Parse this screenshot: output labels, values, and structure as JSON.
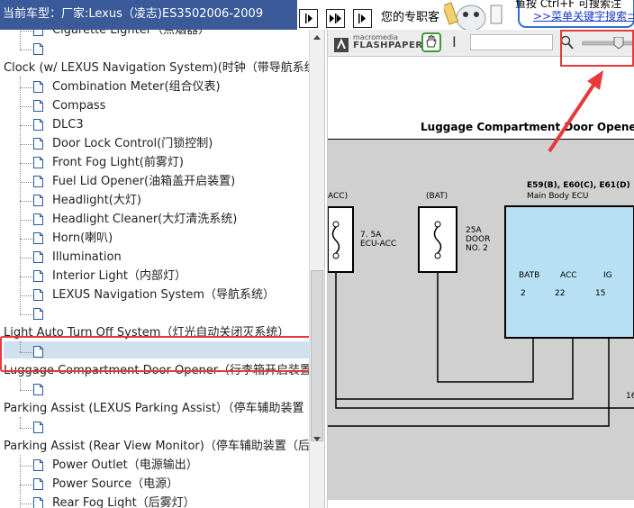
{
  "header": {
    "vehicle_prefix": "当前车型：",
    "vehicle_value": "厂家:Lexus（凌志)ES3502006-2009",
    "expert_label": "您的专职客",
    "tip_line1": "鱼按 Ctrl+F 可搜索注",
    "tip_line2": ">>菜单关键字搜索⊃"
  },
  "tree": {
    "items": [
      {
        "label": "Cigarette Lighter（点烟器）",
        "level": "child"
      },
      {
        "label": "",
        "level": "child"
      },
      {
        "label": "Clock (w/ LEXUS Navigation System)(时钟（带导航系统",
        "level": "parent"
      },
      {
        "label": "Combination Meter(组合仪表)",
        "level": "child"
      },
      {
        "label": "Compass",
        "level": "child"
      },
      {
        "label": "DLC3",
        "level": "child"
      },
      {
        "label": "Door Lock Control(门锁控制)",
        "level": "child"
      },
      {
        "label": "Front Fog Light(前雾灯)",
        "level": "child"
      },
      {
        "label": "Fuel Lid Opener(油箱盖开启装置)",
        "level": "child"
      },
      {
        "label": "Headlight(大灯)",
        "level": "child"
      },
      {
        "label": "Headlight Cleaner(大灯清洗系统)",
        "level": "child"
      },
      {
        "label": "Horn(喇叭)",
        "level": "child"
      },
      {
        "label": "Illumination",
        "level": "child"
      },
      {
        "label": "Interior Light（内部灯）",
        "level": "child"
      },
      {
        "label": "LEXUS Navigation System（导航系统）",
        "level": "child"
      },
      {
        "label": "",
        "level": "child"
      },
      {
        "label": "Light Auto Turn Off System（灯光自动关闭灭系统）",
        "level": "parent"
      },
      {
        "label": "",
        "level": "child"
      },
      {
        "label": "Luggage Compartment Door Opener（行李箱开启装置）",
        "level": "parent",
        "selected": true
      },
      {
        "label": "",
        "level": "child"
      },
      {
        "label": "Parking Assist (LEXUS Parking Assist）（停车辅助装置（",
        "level": "parent"
      },
      {
        "label": "",
        "level": "child"
      },
      {
        "label": "Parking Assist (Rear View Monitor)（停车辅助装置（后监",
        "level": "parent"
      },
      {
        "label": "Power Outlet（电源输出）",
        "level": "child"
      },
      {
        "label": "Power Source（电源）",
        "level": "child"
      },
      {
        "label": "Rear Fog Light（后雾灯）",
        "level": "child"
      },
      {
        "label": "Stop Light（停车灯）",
        "level": "child"
      }
    ]
  },
  "viewer": {
    "brand_small": "macromedia",
    "brand_big": "FLASHPAPER",
    "zoom_level": 0.75
  },
  "document": {
    "title": "Luggage Compartment Door Opener",
    "fuse1_top": "ACC)",
    "fuse1_amp": "7. 5A",
    "fuse1_name": "ECU-ACC",
    "fuse2_top": "(BAT)",
    "fuse2_amp": "25A",
    "fuse2_name1": "DOOR",
    "fuse2_name2": "NO. 2",
    "ecu_code": "E59(B), E60(C), E61(D)",
    "ecu_name": "Main Body ECU",
    "pin_batb": "BATB",
    "pin_acc": "ACC",
    "pin_ig": "IG",
    "pin_num1": "2",
    "pin_num2": "22",
    "pin_num3": "15",
    "page_mark": "16"
  },
  "colors": {
    "header_bg": "#3a5a9a",
    "highlight_red": "#e8393a",
    "selected_bg": "#cfe0ee",
    "diagram_gray": "#d0d0d0",
    "ecu_blue": "#b8e0f4"
  }
}
